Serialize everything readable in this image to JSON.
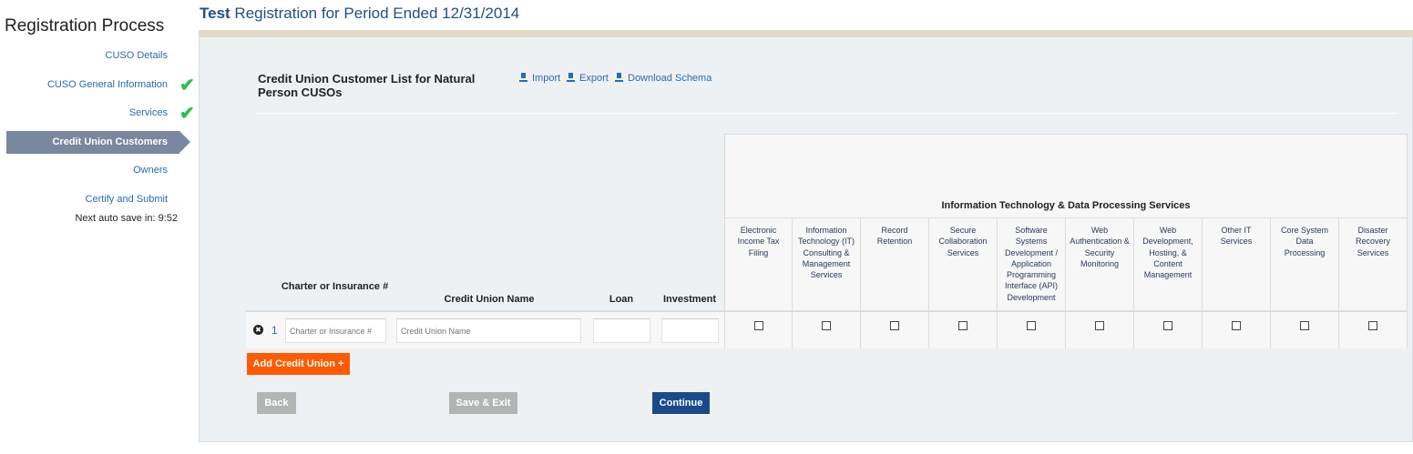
{
  "header": {
    "title_bold": "Test",
    "title_rest": " Registration for Period Ended 12/31/2014"
  },
  "sidebar": {
    "title": "Registration Process",
    "items": [
      {
        "label": "CUSO Details",
        "complete": false
      },
      {
        "label": "CUSO General Information",
        "complete": true
      },
      {
        "label": "Services",
        "complete": true
      },
      {
        "label": "Credit Union Customers",
        "active": true
      },
      {
        "label": "Owners",
        "complete": false
      },
      {
        "label": "Certify and Submit",
        "complete": false
      }
    ],
    "autosave": "Next auto save in: 9:52",
    "check_icon": "✔"
  },
  "section": {
    "title": "Credit Union Customer List for Natural Person CUSOs",
    "tools": [
      "Import",
      "Export",
      "Download Schema"
    ]
  },
  "table": {
    "columns": [
      "Charter or Insurance #",
      "Credit Union Name",
      "Loan",
      "Investment"
    ],
    "group_header": "Information Technology & Data Processing Services",
    "services": [
      "Electronic Income Tax Filing",
      "Information Technology (IT) Consulting & Management Services",
      "Record Retention",
      "Secure Collaboration Services",
      "Software Systems Development / Application Programming Interface (API) Development",
      "Web Authentication & Security Monitoring",
      "Web Development, Hosting, & Content Management",
      "Other IT Services",
      "Core System Data Processing",
      "Disaster Recovery Services"
    ],
    "rows": [
      {
        "number": "1",
        "charter": "",
        "name": "",
        "loan": "",
        "investment": "",
        "checked": [
          false,
          false,
          false,
          false,
          false,
          false,
          false,
          false,
          false,
          false
        ]
      }
    ],
    "placeholders": {
      "charter": "Charter or Insurance #",
      "name": "Credit Union Name"
    },
    "remove_icon": "✖"
  },
  "buttons": {
    "add": "Add Credit Union +",
    "back": "Back",
    "save_exit": "Save & Exit",
    "continue": "Continue"
  },
  "colors": {
    "accent": "#2a6ab0",
    "add": "#ff5a00",
    "continue": "#1a4a8a",
    "disabled": "#b3b5b4",
    "active_nav": "#7a889f"
  }
}
